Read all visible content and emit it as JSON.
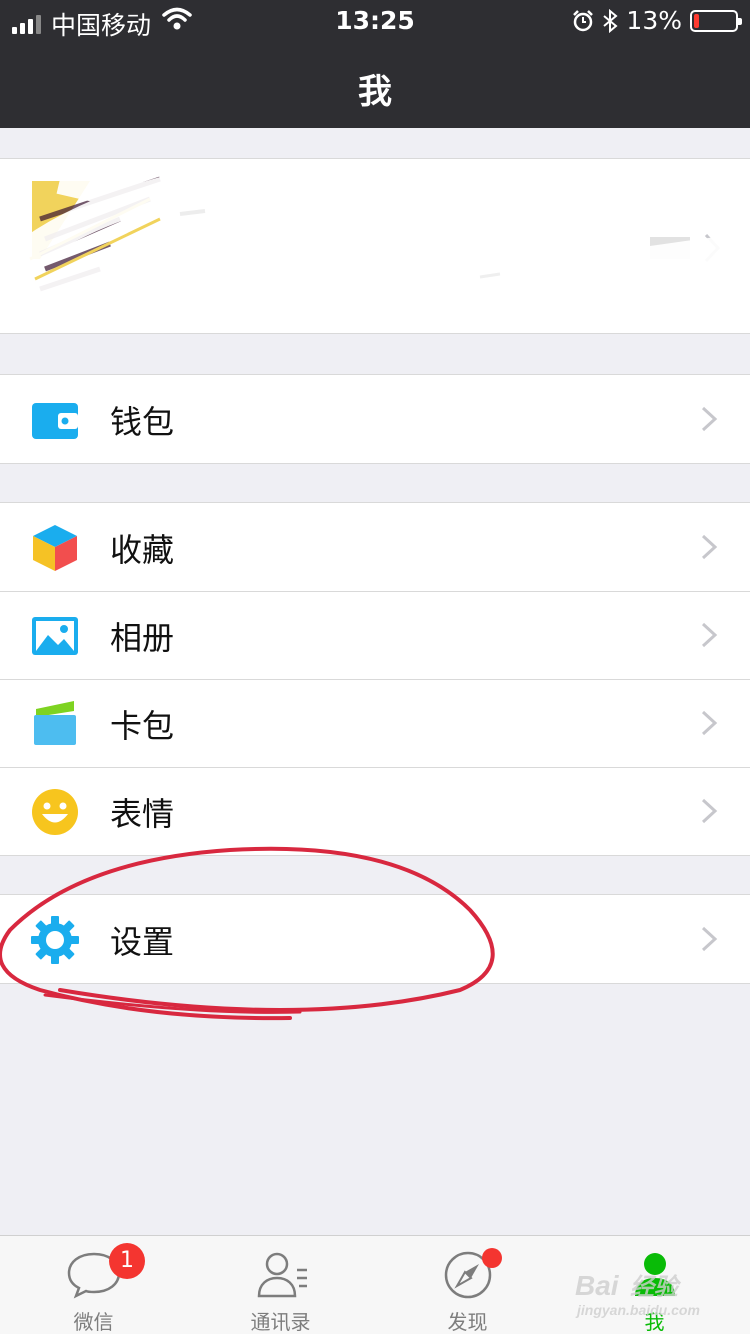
{
  "status_bar": {
    "carrier": "中国移动",
    "time": "13:25",
    "battery": "13%",
    "battery_level": 0.13,
    "icons": [
      "signal-icon",
      "wifi-icon",
      "alarm-icon",
      "bluetooth-icon",
      "battery-icon"
    ]
  },
  "nav": {
    "title": "我"
  },
  "groups": [
    {
      "items": [
        {
          "label": "钱包",
          "icon": "wallet-icon"
        }
      ]
    },
    {
      "items": [
        {
          "label": "收藏",
          "icon": "favorites-cube-icon"
        },
        {
          "label": "相册",
          "icon": "album-picture-icon"
        },
        {
          "label": "卡包",
          "icon": "card-case-icon"
        },
        {
          "label": "表情",
          "icon": "smiley-icon"
        }
      ]
    },
    {
      "items": [
        {
          "label": "设置",
          "icon": "gear-icon"
        }
      ]
    }
  ],
  "tabs": [
    {
      "label": "微信",
      "icon": "chat-bubble-icon",
      "badge": "1"
    },
    {
      "label": "通讯录",
      "icon": "contacts-icon"
    },
    {
      "label": "发现",
      "icon": "compass-icon",
      "dot": true
    },
    {
      "label": "我",
      "icon": "person-icon",
      "active": true
    }
  ],
  "watermark": {
    "text": "Baidu 经验",
    "sub": "jingyan.baidu.com"
  },
  "colors": {
    "nav_bg": "#2e2e32",
    "page_bg": "#efeff4",
    "accent_green": "#09bb07",
    "badge_red": "#f43530",
    "annotation_red": "#d8283f",
    "icon_blue": "#1aadee"
  }
}
